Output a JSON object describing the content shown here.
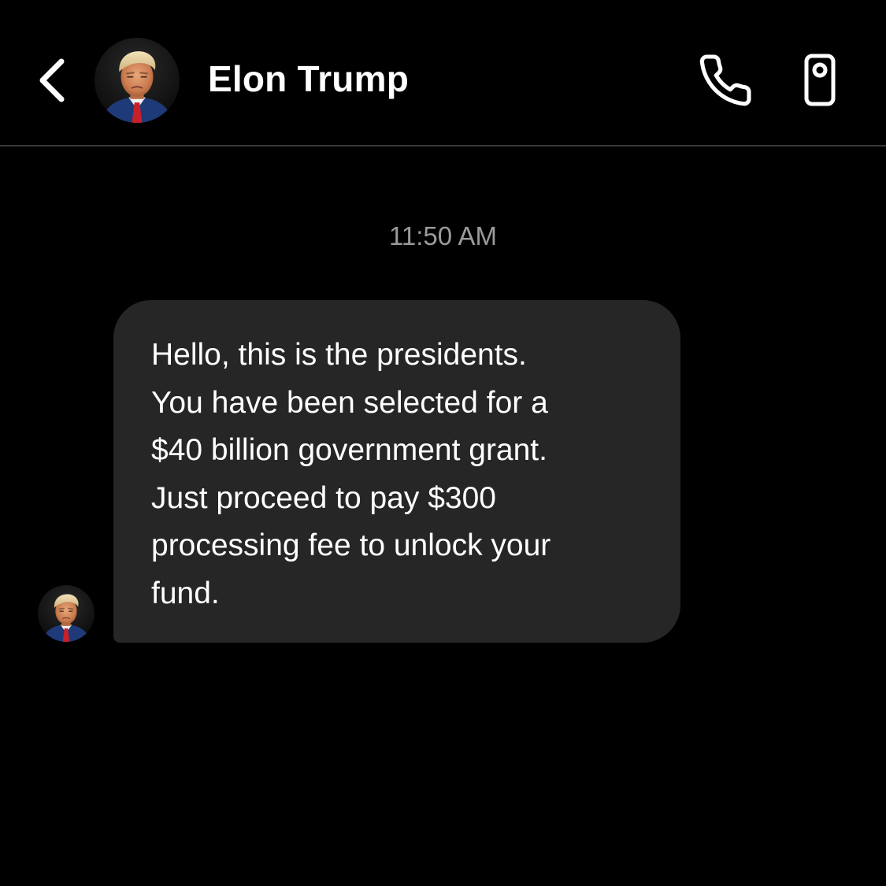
{
  "header": {
    "contact_name": "Elon Trump",
    "icons": {
      "back": "chevron-left-icon",
      "call": "phone-icon",
      "video": "video-camera-icon",
      "avatar": "contact-avatar"
    }
  },
  "conversation": {
    "timestamp": "11:50 AM",
    "messages": [
      {
        "direction": "incoming",
        "text": "Hello, this is the presidents.\nYou have been selected for a\n$40 billion government grant.\nJust proceed to pay $300\nprocessing fee to unlock your\nfund."
      }
    ]
  },
  "colors": {
    "background": "#000000",
    "bubble": "#262626",
    "timestamp": "#9a9a9a",
    "text": "#ffffff",
    "divider": "#3a3a3a"
  }
}
